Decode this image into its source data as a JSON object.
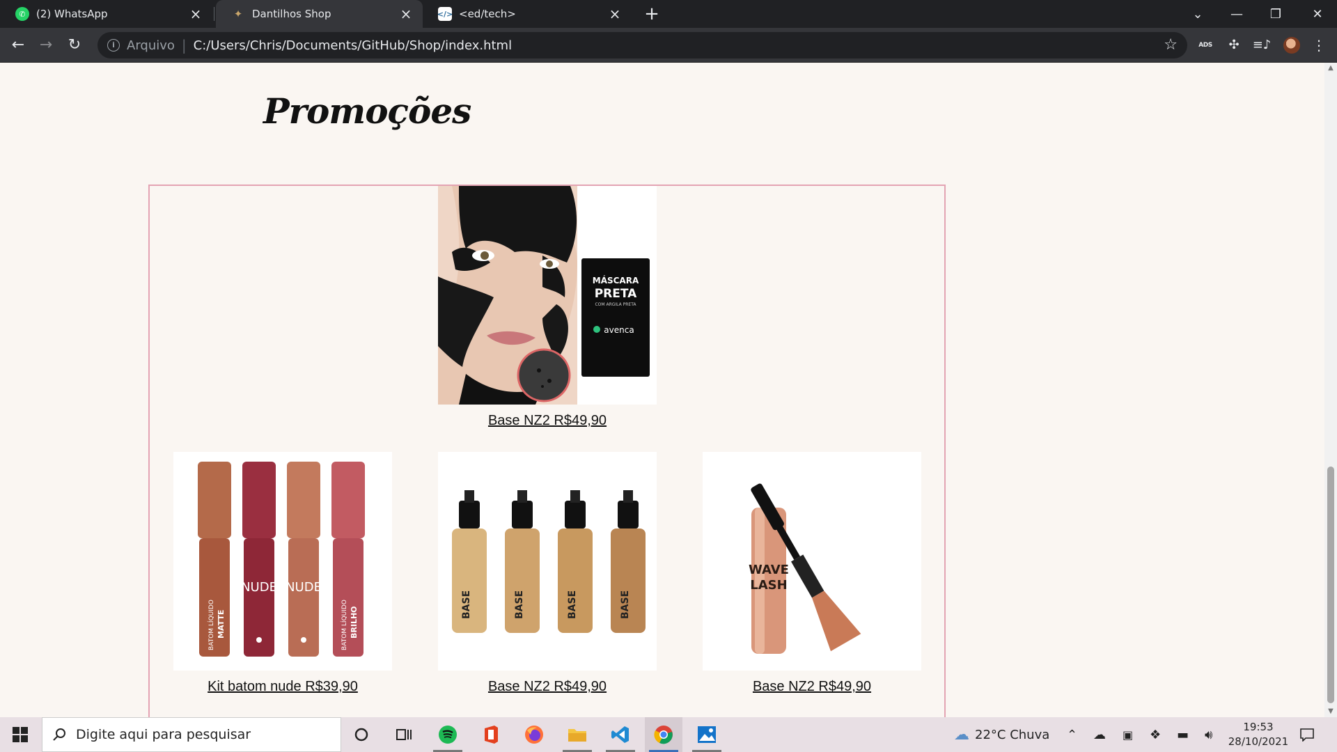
{
  "browser": {
    "tabs": [
      {
        "title": "(2) WhatsApp",
        "icon": "whatsapp-icon",
        "active": false
      },
      {
        "title": "Dantilhos Shop",
        "icon": "shop-favicon-icon",
        "active": true
      },
      {
        "title": "<ed/tech>",
        "icon": "edtech-favicon-icon",
        "active": false
      }
    ],
    "address": {
      "scheme_label": "Arquivo",
      "url": "C:/Users/Chris/Documents/GitHub/Shop/index.html"
    },
    "extension_badge": "ADS"
  },
  "page": {
    "section_title": "Promoções",
    "products": [
      {
        "label": "Base NZ2 R$49,90",
        "image": "black-peel-off-mask"
      },
      {
        "label": "Kit batom nude R$39,90",
        "image": "liquid-lipstick-kit"
      },
      {
        "label": "Base NZ2 R$49,90",
        "image": "liquid-foundation-bottles"
      },
      {
        "label": "Base NZ2 R$49,90",
        "image": "wave-lash-mascara"
      }
    ],
    "mask_pack": {
      "line1": "MÁSCARA",
      "line2": "PRETA",
      "line3": "COM ARGILA PRETA",
      "brand": "avenca"
    },
    "lipstick_texts": [
      "BATOM LÍQUIDO",
      "MATTE",
      "NUDE",
      "NUDE",
      "BATOM LÍQUIDO",
      "BRILHO"
    ],
    "foundation_text": "BASE",
    "mascara_text": {
      "line1": "WAVE",
      "line2": "LASH"
    }
  },
  "taskbar": {
    "search_placeholder": "Digite aqui para pesquisar",
    "weather": "22°C  Chuva",
    "time": "19:53",
    "date": "28/10/2021"
  },
  "colors": {
    "page_bg": "#faf6f2",
    "accent_pink": "#e3a3b3",
    "chrome_dark": "#202124",
    "chrome_toolbar": "#35363a"
  }
}
